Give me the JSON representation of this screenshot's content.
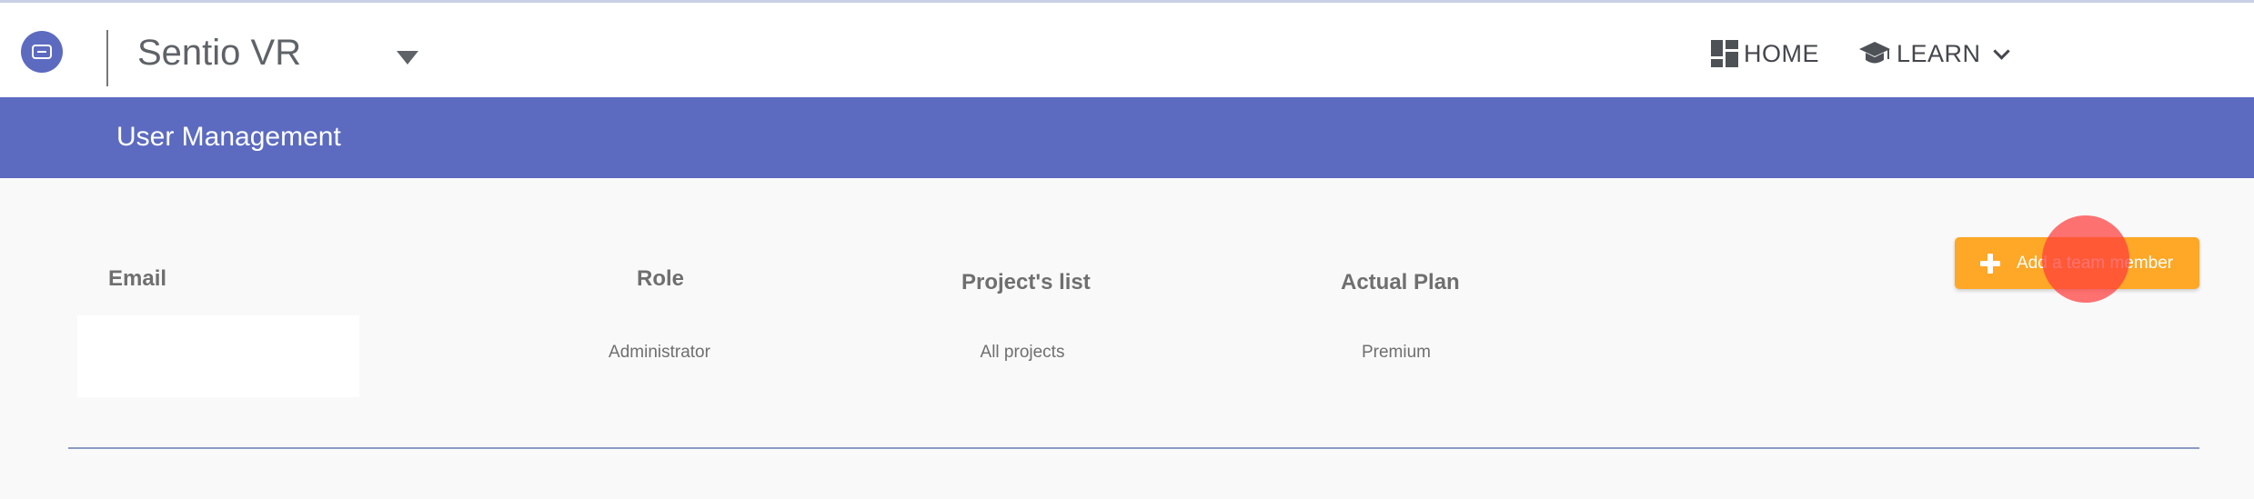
{
  "header": {
    "logo_icon": "vr-headset-icon",
    "app_name": "Sentio VR",
    "nav": {
      "home_label": "HOME",
      "home_icon": "dashboard-icon",
      "learn_label": "LEARN",
      "learn_icon": "graduation-cap-icon"
    }
  },
  "banner": {
    "title": "User Management"
  },
  "table": {
    "columns": [
      "Email",
      "Role",
      "Project's list",
      "Actual Plan"
    ],
    "rows": [
      {
        "email": "",
        "role": "Administrator",
        "projects": "All projects",
        "plan": "Premium"
      }
    ]
  },
  "actions": {
    "add_member_label": "Add a team member",
    "add_member_icon": "plus-icon"
  },
  "colors": {
    "brand": "#5c6bc0",
    "accent": "#ffa726",
    "background": "#f9f9f9"
  }
}
